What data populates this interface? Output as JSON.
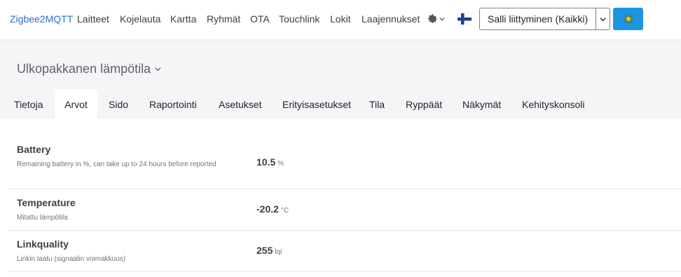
{
  "navbar": {
    "brand": "Zigbee2MQTT",
    "links": [
      "Laitteet",
      "Kojelauta",
      "Kartta",
      "Ryhmät",
      "OTA",
      "Touchlink",
      "Lokit",
      "Laajennukset"
    ],
    "settings_icon": "gear-icon",
    "language_icon": "finland-flag-icon",
    "permit_join_label": "Salli liittyminen (Kaikki)",
    "theme_icon": "sun-icon",
    "accent_color": "#1a97e0"
  },
  "device": {
    "name": "Ulkopakkanen lämpötila"
  },
  "tabs": [
    "Tietoja",
    "Arvot",
    "Sido",
    "Raportointi",
    "Asetukset",
    "Erityisasetukset",
    "Tila",
    "Ryppäät",
    "Näkymät",
    "Kehityskonsoli"
  ],
  "active_tab": "Arvot",
  "exposes": [
    {
      "name": "Battery",
      "description": "Remaining battery in %, can take up to 24 hours before reported",
      "value": "10.5",
      "unit": "%"
    },
    {
      "name": "Temperature",
      "description": "Mitattu lämpötila",
      "value": "-20.2",
      "unit": "°C"
    },
    {
      "name": "Linkquality",
      "description": "Linkin laatu (signaalin voimakkuus)",
      "value": "255",
      "unit": "lqi"
    }
  ]
}
